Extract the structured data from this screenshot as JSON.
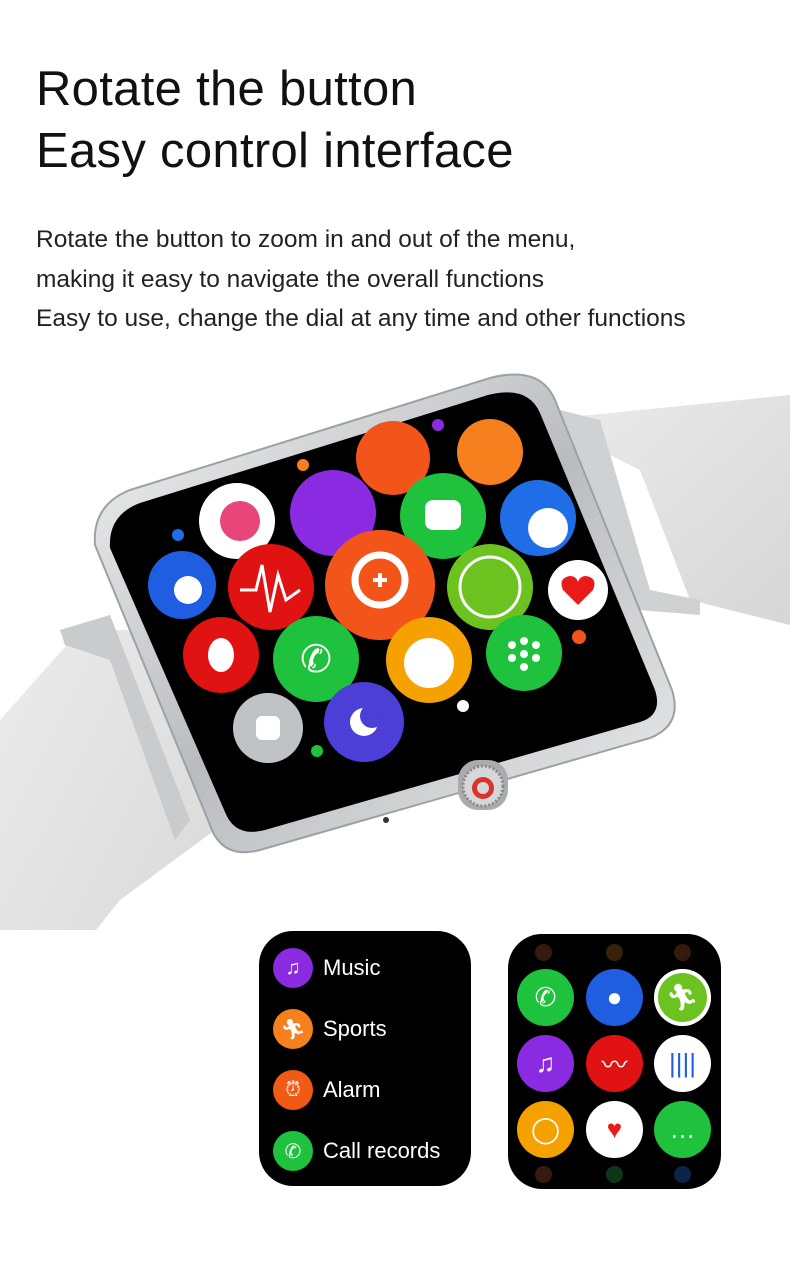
{
  "heading": {
    "line1": "Rotate the button",
    "line2": "Easy control interface"
  },
  "description": {
    "line1": "Rotate the button to zoom in and out of the menu,",
    "line2": "making it easy to navigate the overall functions",
    "line3": "Easy to use, change the dial at any time and other functions"
  },
  "list_screen": {
    "items": [
      {
        "label": "Music",
        "icon": "music-icon",
        "color": "#8a2be2"
      },
      {
        "label": "Sports",
        "icon": "runner-icon",
        "color": "#f7801e"
      },
      {
        "label": "Alarm",
        "icon": "alarm-icon",
        "color": "#f05a14"
      },
      {
        "label": "Call records",
        "icon": "phone-icon",
        "color": "#1fc23c"
      }
    ]
  },
  "grid_screen": {
    "icons": [
      {
        "icon": "phone-icon",
        "color": "#1fc23c"
      },
      {
        "icon": "contacts-icon",
        "color": "#1f5ee0"
      },
      {
        "icon": "running-icon",
        "color": "#6cc21f"
      },
      {
        "icon": "music-icon",
        "color": "#8a2be2"
      },
      {
        "icon": "ecg-icon",
        "color": "#e01212"
      },
      {
        "icon": "voice-icon",
        "color": "#ffffff"
      },
      {
        "icon": "stopwatch-icon",
        "color": "#f5a200"
      },
      {
        "icon": "heart-icon",
        "color": "#ffffff"
      },
      {
        "icon": "message-icon",
        "color": "#1fc23c"
      }
    ]
  },
  "colors": {
    "background": "#ffffff",
    "strap": "#e6e6e6",
    "frame": "#c9cbcd",
    "screen": "#000000",
    "crown_accent": "#d9342b"
  }
}
